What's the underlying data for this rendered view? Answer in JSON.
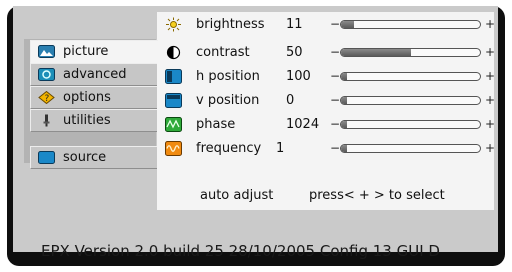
{
  "menu": {
    "items": [
      {
        "label": "picture",
        "icon": "picture-icon",
        "active": true
      },
      {
        "label": "advanced",
        "icon": "advanced-icon",
        "active": false
      },
      {
        "label": "options",
        "icon": "options-icon",
        "active": false
      },
      {
        "label": "utilities",
        "icon": "utilities-icon",
        "active": false
      },
      {
        "label": "source",
        "icon": "source-icon",
        "active": false
      }
    ]
  },
  "settings": {
    "rows": [
      {
        "label": "brightness",
        "value": "11",
        "icon": "sun-icon",
        "slider_level": 0.09
      },
      {
        "label": "contrast",
        "value": "50",
        "icon": "contrast-icon",
        "slider_level": 0.5
      },
      {
        "label": "h position",
        "value": "100",
        "icon": "h-position-icon",
        "slider_level": 0.04
      },
      {
        "label": "v position",
        "value": "0",
        "icon": "v-position-icon",
        "slider_level": 0.04
      },
      {
        "label": "phase",
        "value": "1024",
        "icon": "phase-icon",
        "slider_level": 0.04
      },
      {
        "label": "frequency",
        "value": "1",
        "icon": "frequency-icon",
        "slider_level": 0.04
      }
    ],
    "minus": "−",
    "plus": "+",
    "auto_adjust": "auto adjust",
    "hint": "press< + > to select"
  },
  "status_line": "EPX Version 2.0 build 25   28/10/2005  Config 13   GUI D",
  "colors": {
    "osd_frame": "#0e0e0e",
    "panel_bg": "#cacaca",
    "selected_bg": "#f4f4f4",
    "slider_fill": "#6a6a6a"
  }
}
